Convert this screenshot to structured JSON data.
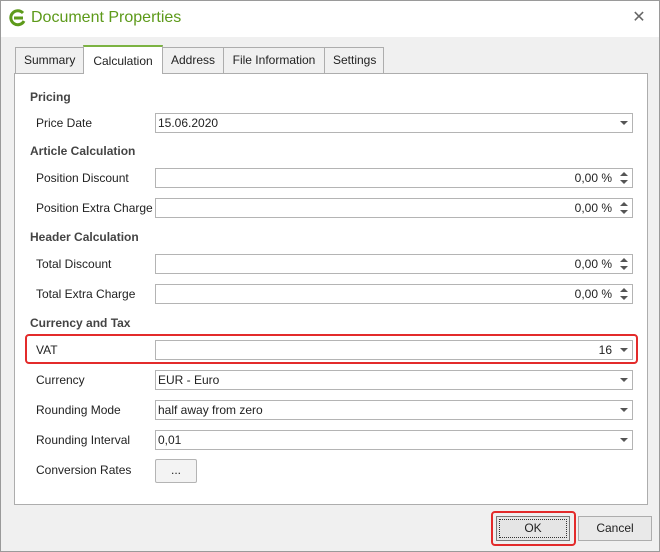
{
  "window": {
    "title": "Document Properties",
    "accent_color": "#7cb342",
    "highlight_color": "#e32b2b"
  },
  "tabs": [
    {
      "label": "Summary"
    },
    {
      "label": "Calculation",
      "active": true
    },
    {
      "label": "Address"
    },
    {
      "label": "File Information"
    },
    {
      "label": "Settings"
    }
  ],
  "sections": {
    "pricing": "Pricing",
    "article": "Article Calculation",
    "header": "Header Calculation",
    "currency": "Currency and Tax"
  },
  "fields": {
    "price_date": {
      "label": "Price Date",
      "value": "15.06.2020"
    },
    "position_discount": {
      "label": "Position Discount",
      "value": "0,00 %"
    },
    "position_extra": {
      "label": "Position Extra Charge",
      "value": "0,00 %"
    },
    "total_discount": {
      "label": "Total Discount",
      "value": "0,00 %"
    },
    "total_extra": {
      "label": "Total Extra Charge",
      "value": "0,00 %"
    },
    "vat": {
      "label": "VAT",
      "value": "16"
    },
    "currency": {
      "label": "Currency",
      "value": "EUR - Euro"
    },
    "rounding_mode": {
      "label": "Rounding Mode",
      "value": "half away from zero"
    },
    "rounding_interval": {
      "label": "Rounding Interval",
      "value": "0,01"
    },
    "conversion_rates": {
      "label": "Conversion Rates",
      "button": "..."
    }
  },
  "buttons": {
    "ok": "OK",
    "cancel": "Cancel"
  },
  "icons": {
    "app": "app-logo-icon",
    "close": "close-icon"
  }
}
